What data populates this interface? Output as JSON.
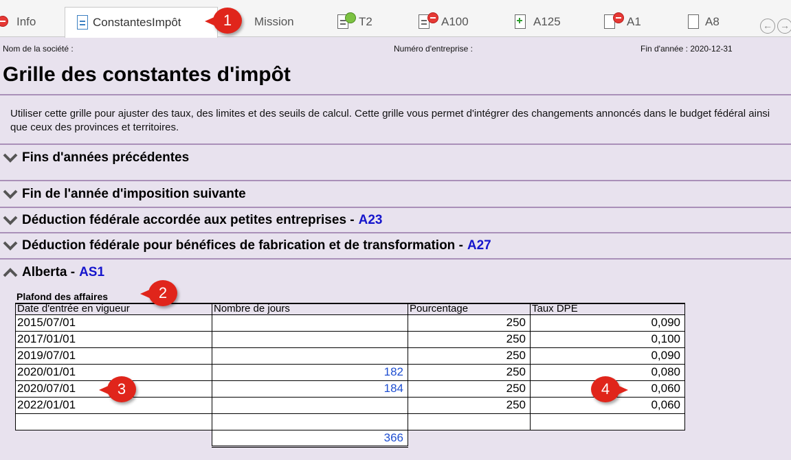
{
  "tabs": [
    {
      "label": "Info"
    },
    {
      "label": "ConstantesImpôt"
    },
    {
      "label": "Mission"
    },
    {
      "label": "T2"
    },
    {
      "label": "A100"
    },
    {
      "label": "A125"
    },
    {
      "label": "A1"
    },
    {
      "label": "A8"
    }
  ],
  "nav": {
    "back": "←",
    "forward": "→"
  },
  "callouts": [
    "1",
    "2",
    "3",
    "4"
  ],
  "header": {
    "company_label": "Nom de la société :",
    "business_number_label": "Numéro d'entreprise :",
    "year_end": "Fin d'année : 2020-12-31"
  },
  "title": "Grille des constantes d'impôt",
  "intro": "Utiliser cette grille pour ajuster des taux, des limites et des seuils de calcul. Cette grille vous permet d'intégrer des changements annoncés dans le budget fédéral ainsi que ceux des provinces et territoires.",
  "sections": [
    {
      "title": "Fins d'années précédentes",
      "link": ""
    },
    {
      "title": "Fin de l'année d'imposition suivante",
      "link": ""
    },
    {
      "title": "Déduction fédérale accordée aux petites entreprises -",
      "link": "A23"
    },
    {
      "title": "Déduction fédérale pour bénéfices de fabrication et de transformation -",
      "link": "A27"
    },
    {
      "title": "Alberta -",
      "link": "AS1"
    }
  ],
  "table": {
    "title": "Plafond des affaires",
    "headers": [
      "Date d'entrée en vigueur",
      "Nombre de jours",
      "Pourcentage",
      "Taux DPE"
    ],
    "rows": [
      [
        "2015/07/01",
        "",
        "250",
        "0,090"
      ],
      [
        "2017/01/01",
        "",
        "250",
        "0,100"
      ],
      [
        "2019/07/01",
        "",
        "250",
        "0,090"
      ],
      [
        "2020/01/01",
        "182",
        "250",
        "0,080"
      ],
      [
        "2020/07/01",
        "184",
        "250",
        "0,060"
      ],
      [
        "2022/01/01",
        "",
        "250",
        "0,060"
      ],
      [
        "",
        "",
        "",
        ""
      ]
    ],
    "total_days": "366"
  }
}
